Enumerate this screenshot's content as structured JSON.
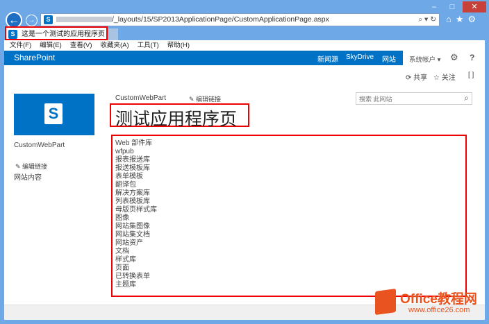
{
  "browser": {
    "url_path": "/_layouts/15/SP2013ApplicationPage/CustomApplicationPage.aspx",
    "tab_title": "这是一个测试的应用程序页",
    "tab_close": "×",
    "minimize": "–",
    "maximize": "□",
    "close": "✕",
    "back": "←",
    "forward": "→",
    "search_glyph": "⌕ ▾ ↻",
    "home": "⌂",
    "star": "★",
    "gear": "⚙"
  },
  "menu": [
    "文件(F)",
    "编辑(E)",
    "查看(V)",
    "收藏夹(A)",
    "工具(T)",
    "帮助(H)"
  ],
  "suite": {
    "brand": "SharePoint",
    "links": [
      "新闻源",
      "SkyDrive",
      "网站"
    ],
    "account": "系统帐户 ▾",
    "settings": "⚙",
    "help": "?"
  },
  "actions": {
    "share": "共享",
    "follow": "关注",
    "focus": "[ ]"
  },
  "site": {
    "logo": "S",
    "name": "CustomWebPart",
    "edit_links": "编辑链接",
    "site_contents": "网站内容"
  },
  "header": {
    "breadcrumb": "CustomWebPart",
    "edit_links": "编辑链接",
    "title": "测试应用程序页",
    "search_placeholder": "搜索 此网站"
  },
  "libraries": [
    "Web 部件库",
    "wfpub",
    "报表报送库",
    "报送模板库",
    "表单模板",
    "翻译包",
    "解决方案库",
    "列表模板库",
    "母版页样式库",
    "图像",
    "网站集图像",
    "网站集文档",
    "网站资产",
    "文档",
    "样式库",
    "页面",
    "已转换表单",
    "主题库"
  ],
  "watermark": {
    "title": "Office教程网",
    "url": "www.office26.com"
  }
}
